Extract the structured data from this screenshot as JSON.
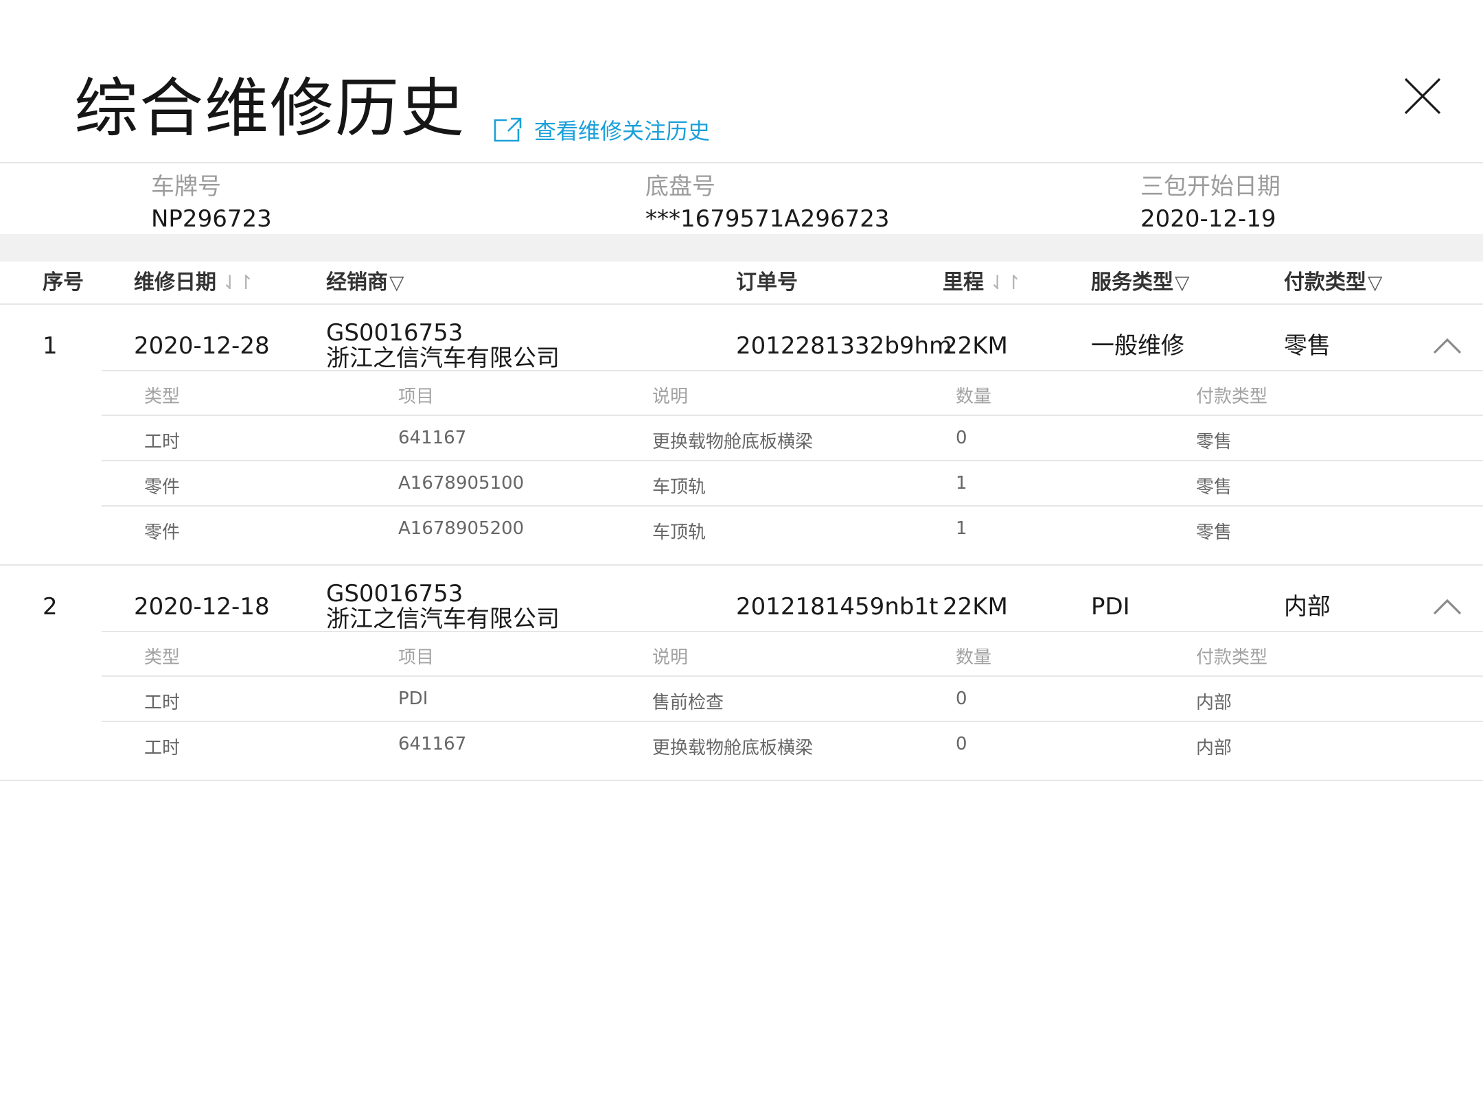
{
  "header": {
    "title": "综合维修历史",
    "link_label": "查看维修关注历史",
    "icons": {
      "link": "external-link-icon",
      "close": "close-icon"
    }
  },
  "vehicle": {
    "plate_label": "车牌号",
    "plate_value": "NP296723",
    "chassis_label": "底盘号",
    "chassis_value": "***1679571A296723",
    "warranty_label": "三包开始日期",
    "warranty_value": "2020-12-19"
  },
  "table": {
    "columns": {
      "index": "序号",
      "date": "维修日期",
      "dealer": "经销商",
      "order": "订单号",
      "mileage": "里程",
      "service": "服务类型",
      "payment": "付款类型"
    },
    "sub_columns": {
      "type": "类型",
      "item": "项目",
      "desc": "说明",
      "qty": "数量",
      "payment": "付款类型"
    },
    "rows": [
      {
        "index": "1",
        "date": "2020-12-28",
        "dealer_code": "GS0016753",
        "dealer_name": "浙江之信汽车有限公司",
        "order": "2012281332b9hm",
        "mileage": "22KM",
        "service": "一般维修",
        "payment": "零售",
        "details": [
          {
            "type": "工时",
            "item": "641167",
            "desc": "更换载物舱底板横梁",
            "qty": "0",
            "payment": "零售"
          },
          {
            "type": "零件",
            "item": "A1678905100",
            "desc": "车顶轨",
            "qty": "1",
            "payment": "零售"
          },
          {
            "type": "零件",
            "item": "A1678905200",
            "desc": "车顶轨",
            "qty": "1",
            "payment": "零售"
          }
        ]
      },
      {
        "index": "2",
        "date": "2020-12-18",
        "dealer_code": "GS0016753",
        "dealer_name": "浙江之信汽车有限公司",
        "order": "2012181459nb1t",
        "mileage": "22KM",
        "service": "PDI",
        "payment": "内部",
        "details": [
          {
            "type": "工时",
            "item": "PDI",
            "desc": "售前检查",
            "qty": "0",
            "payment": "内部"
          },
          {
            "type": "工时",
            "item": "641167",
            "desc": "更换载物舱底板横梁",
            "qty": "0",
            "payment": "内部"
          }
        ]
      }
    ]
  },
  "colors": {
    "accent": "#1aa0d9",
    "divider": "#e6e6e6",
    "band": "#f1f1f1",
    "muted_text": "#9c9c9c"
  }
}
